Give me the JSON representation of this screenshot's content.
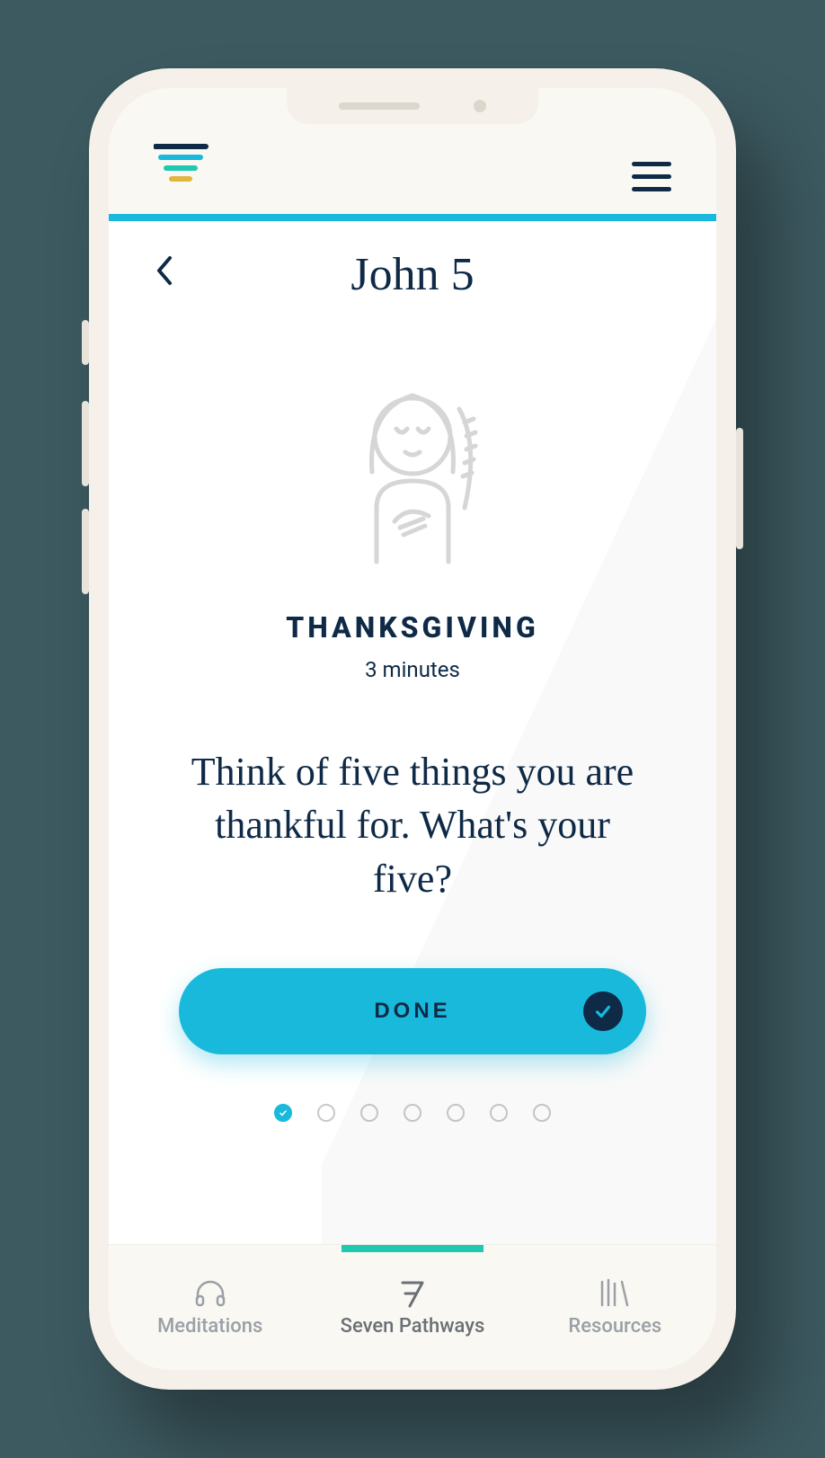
{
  "header": {
    "title": "John 5"
  },
  "section": {
    "heading": "THANKSGIVING",
    "duration": "3 minutes",
    "prompt": "Think of five things you are thankful for. What's your five?"
  },
  "done_button": {
    "label": "DONE"
  },
  "pagination": {
    "total": 7,
    "active_index": 0
  },
  "nav": {
    "items": [
      {
        "label": "Meditations",
        "icon": "headphones-icon",
        "active": false
      },
      {
        "label": "Seven Pathways",
        "icon": "seven-icon",
        "active": true
      },
      {
        "label": "Resources",
        "icon": "books-icon",
        "active": false
      }
    ]
  },
  "colors": {
    "accent": "#19b9dc",
    "dark": "#0e2a47",
    "teal": "#1fc9b0"
  }
}
